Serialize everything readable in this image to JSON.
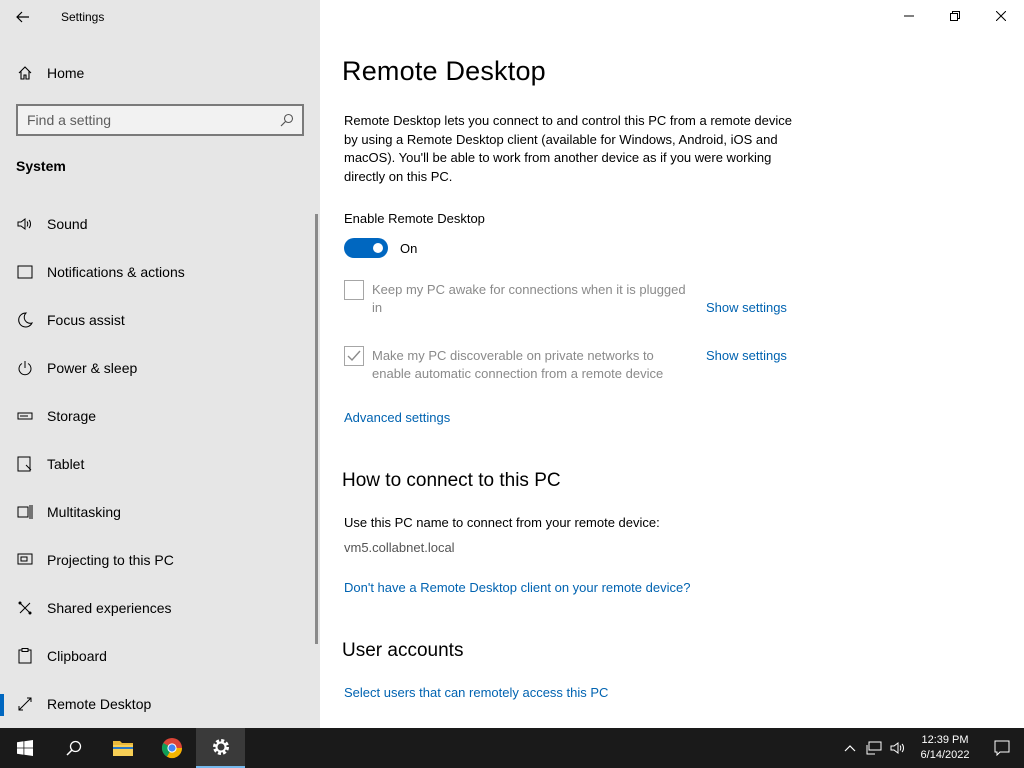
{
  "window": {
    "app_title": "Settings"
  },
  "sidebar": {
    "home_label": "Home",
    "search_placeholder": "Find a setting",
    "group_header": "System",
    "items": [
      {
        "label": "Sound",
        "icon": "speaker-icon"
      },
      {
        "label": "Notifications & actions",
        "icon": "notifications-icon"
      },
      {
        "label": "Focus assist",
        "icon": "moon-icon"
      },
      {
        "label": "Power & sleep",
        "icon": "power-icon"
      },
      {
        "label": "Storage",
        "icon": "storage-icon"
      },
      {
        "label": "Tablet",
        "icon": "tablet-icon"
      },
      {
        "label": "Multitasking",
        "icon": "multitasking-icon"
      },
      {
        "label": "Projecting to this PC",
        "icon": "projecting-icon"
      },
      {
        "label": "Shared experiences",
        "icon": "shared-experiences-icon"
      },
      {
        "label": "Clipboard",
        "icon": "clipboard-icon"
      },
      {
        "label": "Remote Desktop",
        "icon": "remote-desktop-icon",
        "selected": true
      }
    ]
  },
  "main": {
    "title": "Remote Desktop",
    "description": "Remote Desktop lets you connect to and control this PC from a remote device by using a Remote Desktop client (available for Windows, Android, iOS and macOS). You'll be able to work from another device as if you were working directly on this PC.",
    "enable_label": "Enable Remote Desktop",
    "toggle_state": "On",
    "toggle_on": true,
    "options": [
      {
        "text": "Keep my PC awake for connections when it is plugged in",
        "checked": false,
        "link": "Show settings"
      },
      {
        "text": "Make my PC discoverable on private networks to enable automatic connection from a remote device",
        "checked": true,
        "link": "Show settings"
      }
    ],
    "advanced_link": "Advanced settings",
    "connect_heading": "How to connect to this PC",
    "connect_text": "Use this PC name to connect from your remote device:",
    "pc_name": "vm5.collabnet.local",
    "client_link": "Don't have a Remote Desktop client on your remote device?",
    "accounts_heading": "User accounts",
    "accounts_link": "Select users that can remotely access this PC"
  },
  "taskbar": {
    "time": "12:39 PM",
    "date": "6/14/2022",
    "accent_color": "#76b9ed"
  },
  "colors": {
    "accent": "#0067c0",
    "link": "#0063b1",
    "sidebar_bg": "#e6e6e6"
  }
}
